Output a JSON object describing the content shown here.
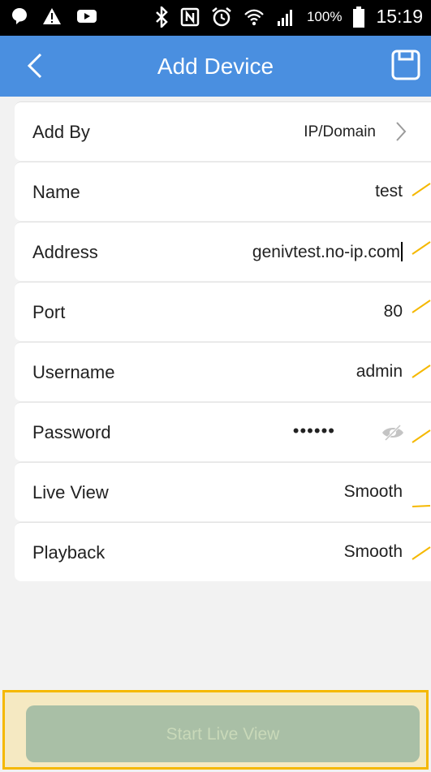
{
  "status_bar": {
    "battery_percent": "100%",
    "time": "15:19",
    "left_icons": [
      "message-icon",
      "warning-icon",
      "youtube-icon"
    ],
    "right_icons": [
      "bluetooth-icon",
      "nfc-icon",
      "alarm-icon",
      "wifi-icon",
      "signal-icon",
      "battery-icon"
    ]
  },
  "header": {
    "title": "Add Device",
    "back_icon": "chevron-left-icon",
    "save_icon": "save-icon"
  },
  "form": {
    "rows": [
      {
        "label": "Add By",
        "value": "IP/Domain"
      },
      {
        "label": "Name",
        "value": "test"
      },
      {
        "label": "Address",
        "value": "genivtest.no-ip.com"
      },
      {
        "label": "Port",
        "value": "80"
      },
      {
        "label": "Username",
        "value": "admin"
      },
      {
        "label": "Password",
        "value": "••••••"
      },
      {
        "label": "Live View",
        "value": "Smooth"
      },
      {
        "label": "Playback",
        "value": "Smooth"
      }
    ]
  },
  "footer": {
    "start_live_view_label": "Start Live View"
  },
  "colors": {
    "header_blue": "#4a8fe0",
    "button_disabled": "#a9bfa6",
    "highlight_fill": "#f5e9c2",
    "highlight_border": "#f5b800",
    "annotation_line": "#f5b800"
  }
}
